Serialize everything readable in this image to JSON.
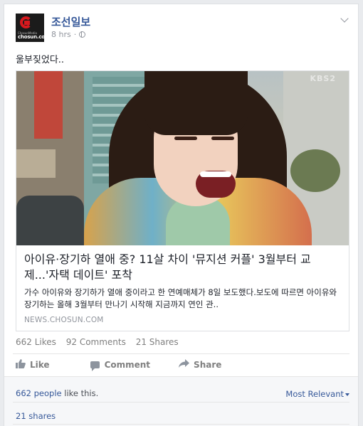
{
  "post": {
    "page_name": "조선일보",
    "time": "8 hrs",
    "privacy_icon": "globe-icon",
    "logo": {
      "brand": "chosun.com",
      "tagline": "ChosunMedia"
    },
    "text": "울부짖었다.."
  },
  "link_preview": {
    "image_watermark": "KBS2",
    "title": "아이유·장기하 열애 중? 11살 차이 '뮤지션 커플' 3월부터 교제...'자택 데이트' 포착",
    "description": "가수 아이유와 장기하가 열애 중이라고 한 연예매체가 8일 보도했다.보도에 따르면 아이유와 장기하는 올해 3월부터 만나기 시작해 지금까지 연인 관..",
    "domain": "NEWS.CHOSUN.COM"
  },
  "counts": {
    "likes": "662 Likes",
    "comments": "92 Comments",
    "shares": "21 Shares"
  },
  "actions": {
    "like": "Like",
    "comment": "Comment",
    "share": "Share"
  },
  "ufi": {
    "people_count": "662 people",
    "people_suffix": " like this.",
    "sort": "Most Relevant",
    "shares": "21 shares"
  },
  "colors": {
    "link": "#365899",
    "meta": "#90949c",
    "background": "#e9ebee"
  }
}
